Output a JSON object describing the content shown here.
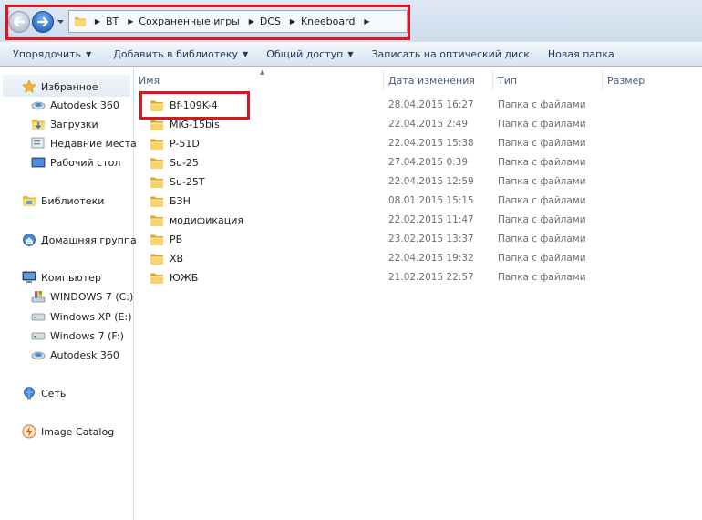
{
  "address": {
    "crumbs": [
      "BT",
      "Сохраненные игры",
      "DCS",
      "Kneeboard"
    ]
  },
  "toolbar": {
    "organize": "Упорядочить",
    "add_to_library": "Добавить в библиотеку",
    "share": "Общий доступ",
    "burn": "Записать на оптический диск",
    "new_folder": "Новая папка"
  },
  "nav": {
    "favorites": "Избранное",
    "autodesk": "Autodesk 360",
    "downloads": "Загрузки",
    "recent": "Недавние места",
    "desktop": "Рабочий стол",
    "libraries": "Библиотеки",
    "homegroup": "Домашняя группа",
    "computer": "Компьютер",
    "drive_c": "WINDOWS 7 (C:)",
    "drive_e": "Windows XP (E:)",
    "drive_f": "Windows 7 (F:)",
    "autodesk2": "Autodesk 360",
    "network": "Сеть",
    "image_catalog": "Image Catalog"
  },
  "columns": {
    "name": "Имя",
    "date": "Дата изменения",
    "type": "Тип",
    "size": "Размер"
  },
  "files": [
    {
      "name": "Bf-109K-4",
      "date": "28.04.2015 16:27",
      "type": "Папка с файлами"
    },
    {
      "name": "MiG-15bis",
      "date": "22.04.2015 2:49",
      "type": "Папка с файлами"
    },
    {
      "name": "P-51D",
      "date": "22.04.2015 15:38",
      "type": "Папка с файлами"
    },
    {
      "name": "Su-25",
      "date": "27.04.2015 0:39",
      "type": "Папка с файлами"
    },
    {
      "name": "Su-25T",
      "date": "22.04.2015 12:59",
      "type": "Папка с файлами"
    },
    {
      "name": "БЗН",
      "date": "08.01.2015 15:15",
      "type": "Папка с файлами"
    },
    {
      "name": "модификация",
      "date": "22.02.2015 11:47",
      "type": "Папка с файлами"
    },
    {
      "name": "РВ",
      "date": "23.02.2015 13:37",
      "type": "Папка с файлами"
    },
    {
      "name": "ХВ",
      "date": "22.04.2015 19:32",
      "type": "Папка с файлами"
    },
    {
      "name": "ЮЖБ",
      "date": "21.02.2015 22:57",
      "type": "Папка с файлами"
    }
  ],
  "colors": {
    "highlight": "#e0141e",
    "folder": "#f2c94c"
  }
}
